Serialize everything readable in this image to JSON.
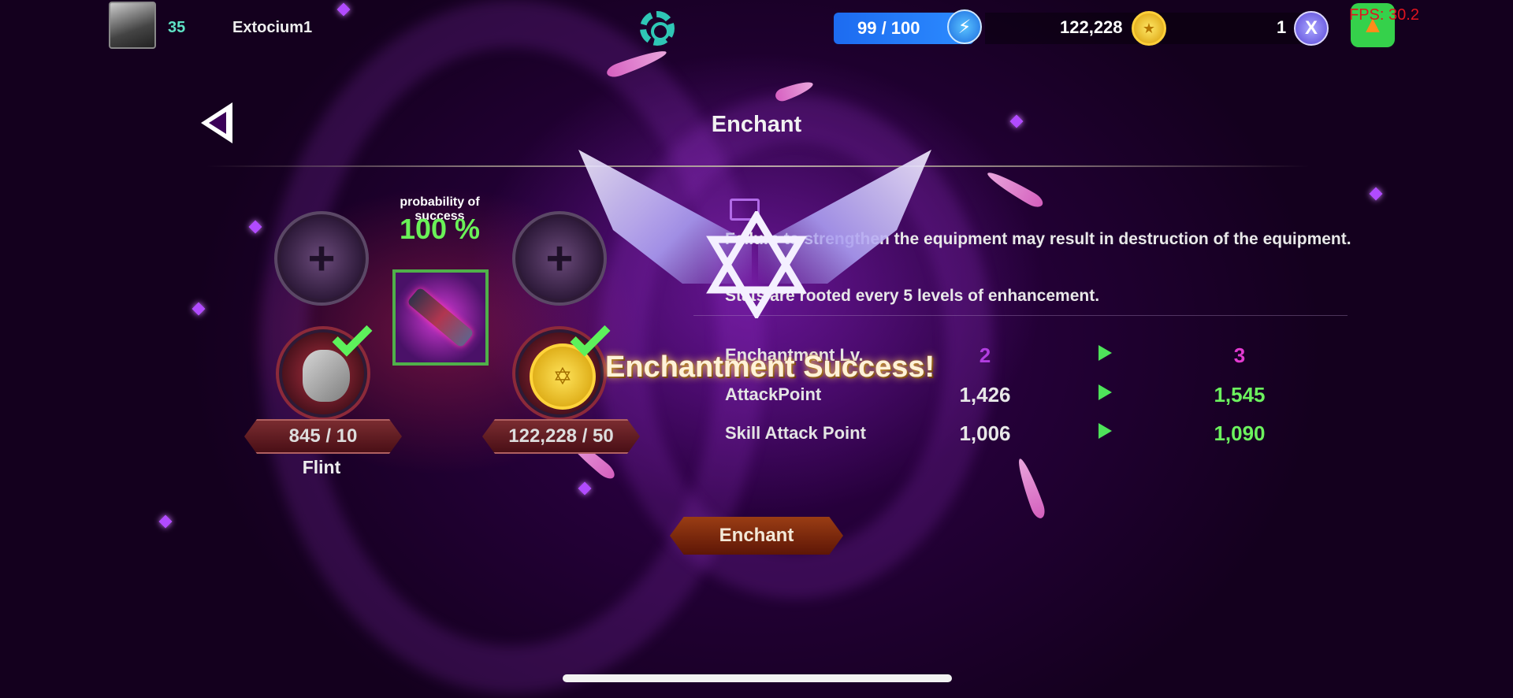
{
  "player": {
    "level": "35",
    "name": "Extocium1"
  },
  "resources": {
    "energy": "99 / 100",
    "gold": "122,228",
    "x_token": "1"
  },
  "fps": "FPS: 30.2",
  "screen": {
    "title": "Enchant"
  },
  "probability": {
    "label": "probability of success",
    "value": "100 %"
  },
  "materials": {
    "flint_count": "845 / 10",
    "flint_name": "Flint",
    "gold_count": "122,228 / 50"
  },
  "info": {
    "line1": "Failure to strengthen the equipment may result in destruction of the equipment.",
    "line2": "Stats are rooted every 5 levels of enhancement."
  },
  "stats": [
    {
      "label": "Enchantment Lv.",
      "current": "2",
      "next": "3"
    },
    {
      "label": "AttackPoint",
      "current": "1,426",
      "next": "1,545"
    },
    {
      "label": "Skill Attack Point",
      "current": "1,006",
      "next": "1,090"
    }
  ],
  "popup": {
    "message": "Enchantment Success!"
  },
  "actions": {
    "enchant_label": "Enchant"
  },
  "colors": {
    "level_next": "#e23bd0",
    "level_current": "#b13de0",
    "stat_next": "#6cf25e",
    "probability": "#6af158"
  }
}
